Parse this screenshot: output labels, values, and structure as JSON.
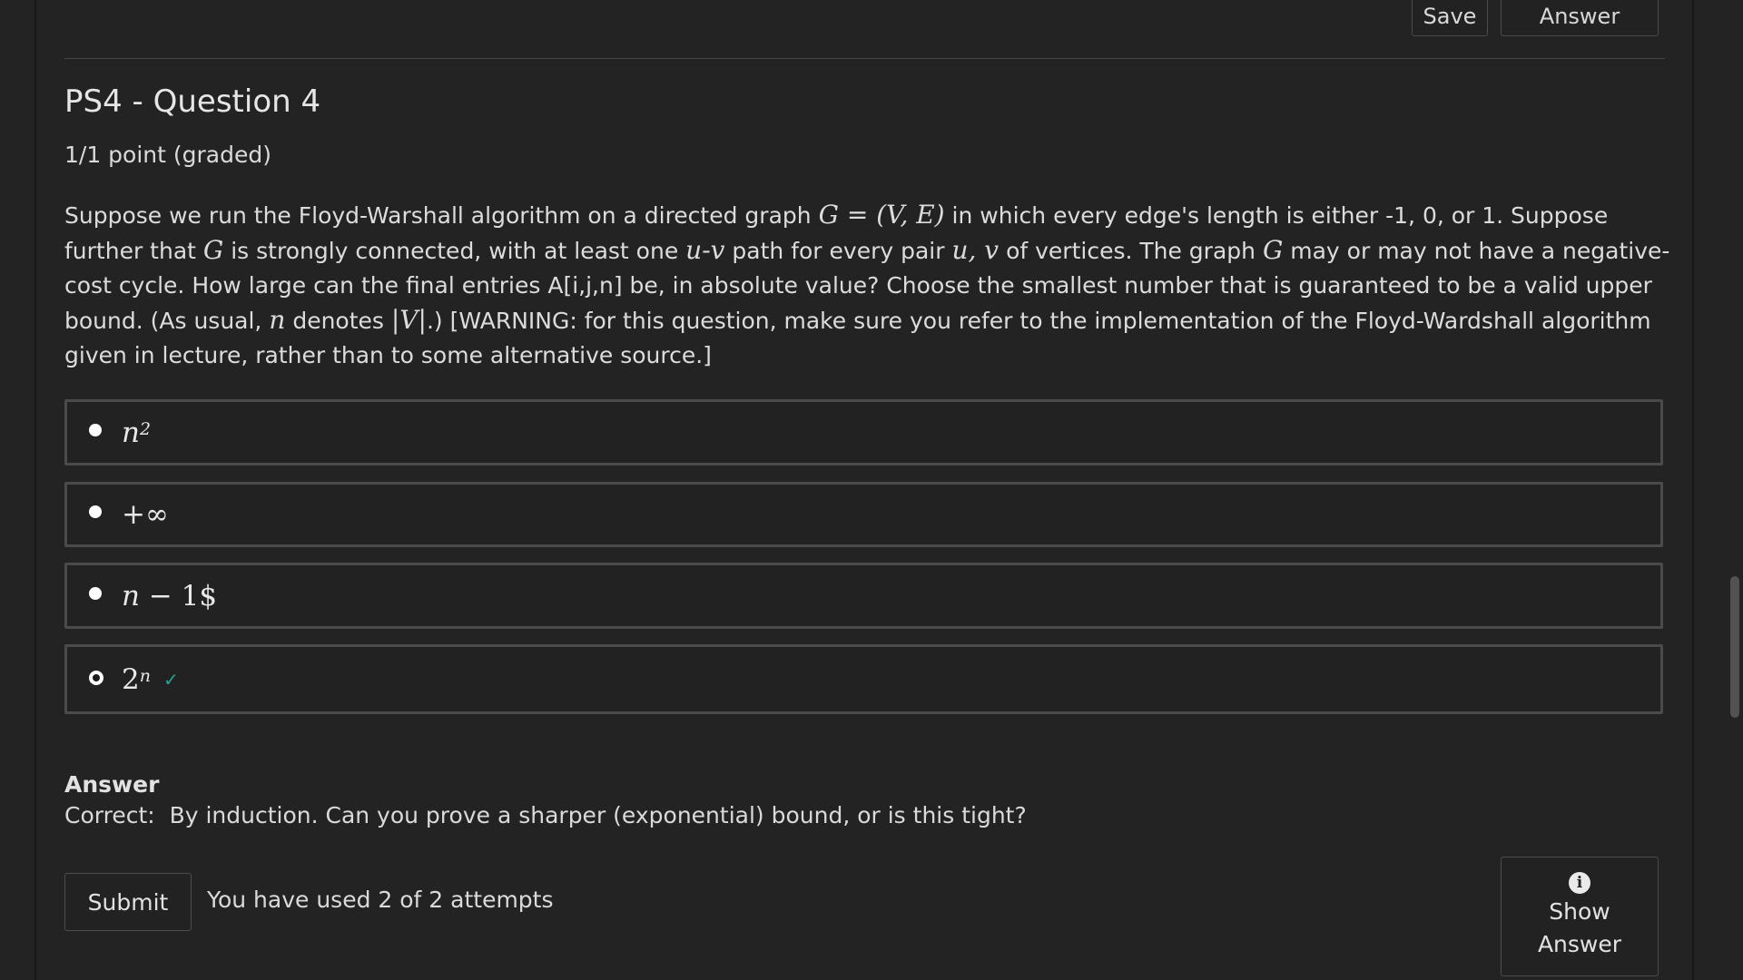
{
  "toolbar": {
    "save_label": "Save",
    "answer_label": "Answer"
  },
  "problem": {
    "title": "PS4 - Question 4",
    "points": "1/1 point (graded)",
    "prompt": {
      "p1": "Suppose we run the Floyd-Warshall algorithm on a directed graph ",
      "m_graph": "G = (V, E)",
      "p2": " in which every edge's length is either -1, 0, or 1. Suppose further that ",
      "m_g1": "G",
      "p3": " is strongly connected, with at least one ",
      "m_uv": "u-v",
      "p4": " path for every pair ",
      "m_pair": "u, v",
      "p5": " of vertices. The graph ",
      "m_g2": "G",
      "p6": " may or may not have a negative-cost cycle. How large can the final entries A[i,j,n] be, in absolute value? Choose the smallest number that is guaranteed to be a valid upper bound. (As usual, ",
      "m_n": "n",
      "p7": " denotes ",
      "m_absv": "|V|",
      "p8": ".) [WARNING: for this question, make sure you refer to the implementation of the Floyd-Wardshall algorithm given in lecture, rather than to some alternative source.]"
    },
    "choices": [
      {
        "base": "n",
        "sup": "2",
        "selected": false
      },
      {
        "text": "+∞",
        "selected": false
      },
      {
        "text_italic": "n",
        "text_rest": " − 1$",
        "selected": false
      },
      {
        "base": "2",
        "sup": "n",
        "selected": true,
        "status_icon": "check-icon"
      }
    ],
    "answer": {
      "heading": "Answer",
      "text": "Correct:  By induction. Can you prove a sharper (exponential) bound, or is this tight?"
    },
    "submit_label": "Submit",
    "attempts_text": "You have used 2 of 2 attempts",
    "show_answer_line1": "Show",
    "show_answer_line2": "Answer",
    "icons": {
      "info": "info-icon",
      "check": "check-icon"
    },
    "colors": {
      "background": "#232323",
      "correct": "#1ea691"
    }
  }
}
